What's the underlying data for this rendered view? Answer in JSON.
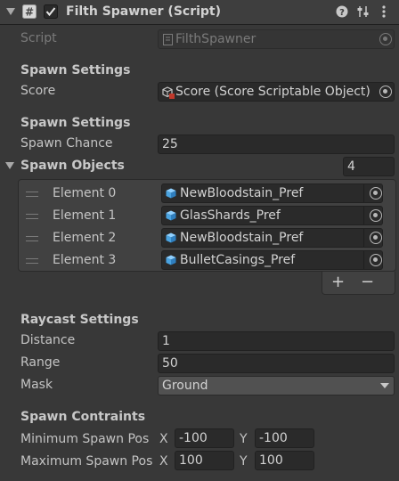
{
  "header": {
    "title": "Filth Spawner (Script)",
    "enabled": true
  },
  "script": {
    "label": "Script",
    "value": "FilthSpawner"
  },
  "spawn_settings_1": {
    "heading": "Spawn Settings",
    "score_label": "Score",
    "score_value": "Score (Score Scriptable Object)"
  },
  "spawn_settings_2": {
    "heading": "Spawn Settings",
    "chance_label": "Spawn Chance",
    "chance_value": "25"
  },
  "spawn_objects": {
    "label": "Spawn Objects",
    "count": "4",
    "expanded": true,
    "elements": [
      {
        "label": "Element 0",
        "value": "NewBloodstain_Pref"
      },
      {
        "label": "Element 1",
        "value": "GlasShards_Pref"
      },
      {
        "label": "Element 2",
        "value": "NewBloodstain_Pref"
      },
      {
        "label": "Element 3",
        "value": "BulletCasings_Pref"
      }
    ],
    "add_label": "+",
    "remove_label": "−"
  },
  "raycast": {
    "heading": "Raycast Settings",
    "distance_label": "Distance",
    "distance_value": "1",
    "range_label": "Range",
    "range_value": "50",
    "mask_label": "Mask",
    "mask_value": "Ground"
  },
  "constraints": {
    "heading": "Spawn Contraints",
    "min_label": "Minimum Spawn Pos",
    "min_x": "-100",
    "min_y": "-100",
    "max_label": "Maximum Spawn Pos",
    "max_x": "100",
    "max_y": "100",
    "x_label": "X",
    "y_label": "Y"
  },
  "colors": {
    "background": "#383838",
    "header": "#3e3e3e",
    "field": "#2a2a2a",
    "text": "#c4c4c4",
    "cube_icon": "#4aa3e0"
  },
  "icons": [
    "foldout-arrow-icon",
    "script-hash-icon",
    "checkbox-icon",
    "help-icon",
    "preset-icon",
    "more-menu-icon",
    "object-picker-icon",
    "prefab-cube-icon",
    "drag-handle-icon",
    "dropdown-arrow-icon"
  ]
}
